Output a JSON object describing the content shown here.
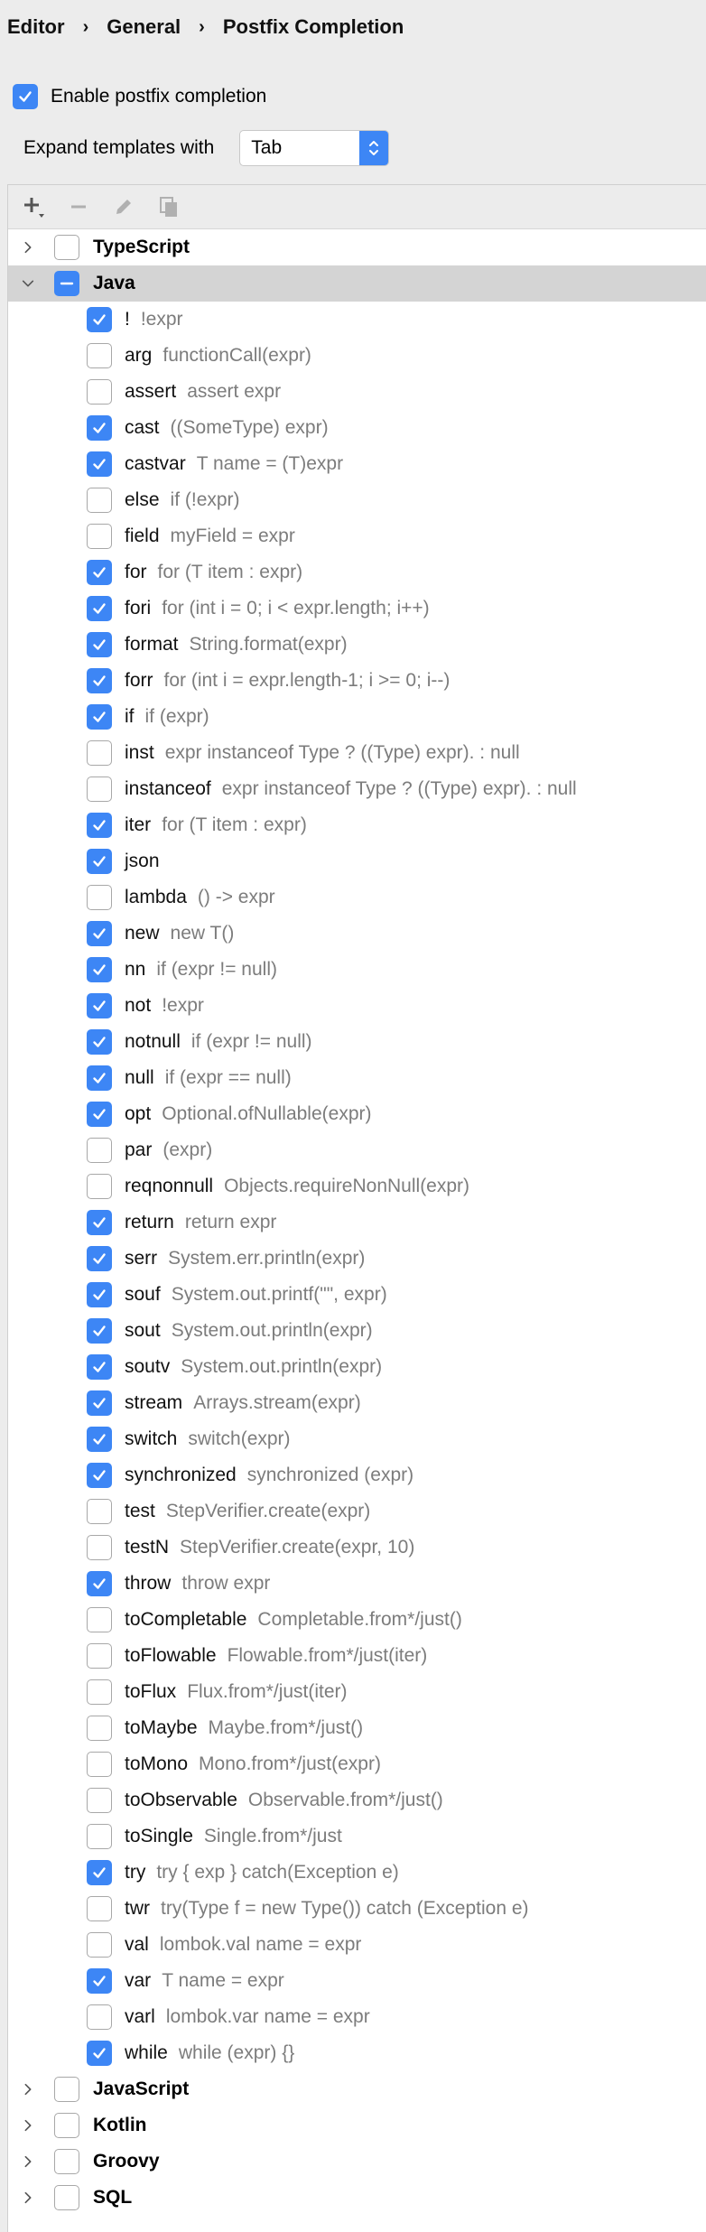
{
  "breadcrumb": [
    "Editor",
    "General",
    "Postfix Completion"
  ],
  "enable": {
    "label": "Enable postfix completion",
    "checked": true
  },
  "expand": {
    "label": "Expand templates with",
    "value": "Tab"
  },
  "toolbar": {
    "add_icon": "add-icon",
    "remove_icon": "remove-icon",
    "edit_icon": "edit-icon",
    "copy_icon": "copy-icon"
  },
  "colors": {
    "accent": "#3d86f5",
    "selected_row": "#d4d4d4",
    "example_text": "#7c7c7c"
  },
  "tree": {
    "categories": [
      {
        "name": "TypeScript",
        "state": "unchecked",
        "expanded": false
      },
      {
        "name": "Java",
        "state": "partial",
        "expanded": true,
        "selected": true,
        "templates": [
          {
            "key": "!",
            "example": "!expr",
            "checked": true
          },
          {
            "key": "arg",
            "example": "functionCall(expr)",
            "checked": false
          },
          {
            "key": "assert",
            "example": "assert expr",
            "checked": false
          },
          {
            "key": "cast",
            "example": "((SomeType) expr)",
            "checked": true
          },
          {
            "key": "castvar",
            "example": "T name = (T)expr",
            "checked": true
          },
          {
            "key": "else",
            "example": "if (!expr)",
            "checked": false
          },
          {
            "key": "field",
            "example": "myField = expr",
            "checked": false
          },
          {
            "key": "for",
            "example": "for (T item : expr)",
            "checked": true
          },
          {
            "key": "fori",
            "example": "for (int i = 0; i < expr.length; i++)",
            "checked": true
          },
          {
            "key": "format",
            "example": "String.format(expr)",
            "checked": true
          },
          {
            "key": "forr",
            "example": "for (int i = expr.length-1; i >= 0; i--)",
            "checked": true
          },
          {
            "key": "if",
            "example": "if (expr)",
            "checked": true
          },
          {
            "key": "inst",
            "example": "expr instanceof Type ? ((Type) expr). : null",
            "checked": false
          },
          {
            "key": "instanceof",
            "example": "expr instanceof Type ? ((Type) expr). : null",
            "checked": false
          },
          {
            "key": "iter",
            "example": "for (T item : expr)",
            "checked": true
          },
          {
            "key": "json",
            "example": "",
            "checked": true
          },
          {
            "key": "lambda",
            "example": "() -> expr",
            "checked": false
          },
          {
            "key": "new",
            "example": "new T()",
            "checked": true
          },
          {
            "key": "nn",
            "example": "if (expr != null)",
            "checked": true
          },
          {
            "key": "not",
            "example": "!expr",
            "checked": true
          },
          {
            "key": "notnull",
            "example": "if (expr != null)",
            "checked": true
          },
          {
            "key": "null",
            "example": "if (expr == null)",
            "checked": true
          },
          {
            "key": "opt",
            "example": "Optional.ofNullable(expr)",
            "checked": true
          },
          {
            "key": "par",
            "example": "(expr)",
            "checked": false
          },
          {
            "key": "reqnonnull",
            "example": "Objects.requireNonNull(expr)",
            "checked": false
          },
          {
            "key": "return",
            "example": "return expr",
            "checked": true
          },
          {
            "key": "serr",
            "example": "System.err.println(expr)",
            "checked": true
          },
          {
            "key": "souf",
            "example": "System.out.printf(\"\", expr)",
            "checked": true
          },
          {
            "key": "sout",
            "example": "System.out.println(expr)",
            "checked": true
          },
          {
            "key": "soutv",
            "example": "System.out.println(expr)",
            "checked": true
          },
          {
            "key": "stream",
            "example": "Arrays.stream(expr)",
            "checked": true
          },
          {
            "key": "switch",
            "example": "switch(expr)",
            "checked": true
          },
          {
            "key": "synchronized",
            "example": "synchronized (expr)",
            "checked": true
          },
          {
            "key": "test",
            "example": "StepVerifier.create(expr)",
            "checked": false
          },
          {
            "key": "testN",
            "example": "StepVerifier.create(expr, 10)",
            "checked": false
          },
          {
            "key": "throw",
            "example": "throw expr",
            "checked": true
          },
          {
            "key": "toCompletable",
            "example": "Completable.from*/just()",
            "checked": false
          },
          {
            "key": "toFlowable",
            "example": "Flowable.from*/just(iter)",
            "checked": false
          },
          {
            "key": "toFlux",
            "example": "Flux.from*/just(iter)",
            "checked": false
          },
          {
            "key": "toMaybe",
            "example": "Maybe.from*/just()",
            "checked": false
          },
          {
            "key": "toMono",
            "example": "Mono.from*/just(expr)",
            "checked": false
          },
          {
            "key": "toObservable",
            "example": "Observable.from*/just()",
            "checked": false
          },
          {
            "key": "toSingle",
            "example": "Single.from*/just",
            "checked": false
          },
          {
            "key": "try",
            "example": "try { exp } catch(Exception e)",
            "checked": true
          },
          {
            "key": "twr",
            "example": "try(Type f = new Type()) catch (Exception e)",
            "checked": false
          },
          {
            "key": "val",
            "example": "lombok.val name = expr",
            "checked": false
          },
          {
            "key": "var",
            "example": "T name = expr",
            "checked": true
          },
          {
            "key": "varl",
            "example": "lombok.var name = expr",
            "checked": false
          },
          {
            "key": "while",
            "example": "while (expr) {}",
            "checked": true
          }
        ]
      },
      {
        "name": "JavaScript",
        "state": "unchecked",
        "expanded": false
      },
      {
        "name": "Kotlin",
        "state": "unchecked",
        "expanded": false
      },
      {
        "name": "Groovy",
        "state": "unchecked",
        "expanded": false
      },
      {
        "name": "SQL",
        "state": "unchecked",
        "expanded": false
      }
    ]
  }
}
